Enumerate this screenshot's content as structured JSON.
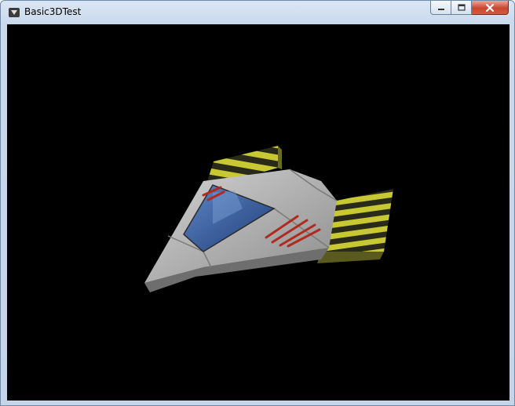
{
  "window": {
    "title": "Basic3DTest"
  },
  "controls": {
    "minimize_icon": "minimize-icon",
    "maximize_icon": "maximize-icon",
    "close_icon": "close-icon"
  },
  "viewport": {
    "background": "#000000",
    "model": "spaceship"
  },
  "colors": {
    "hull": "#b9b9b9",
    "hull_dark": "#6e6e6e",
    "cockpit": "#3a5a9c",
    "stripe_yellow": "#c8c832",
    "stripe_dark": "#2a2a1a",
    "marking_red": "#b02a1e"
  }
}
